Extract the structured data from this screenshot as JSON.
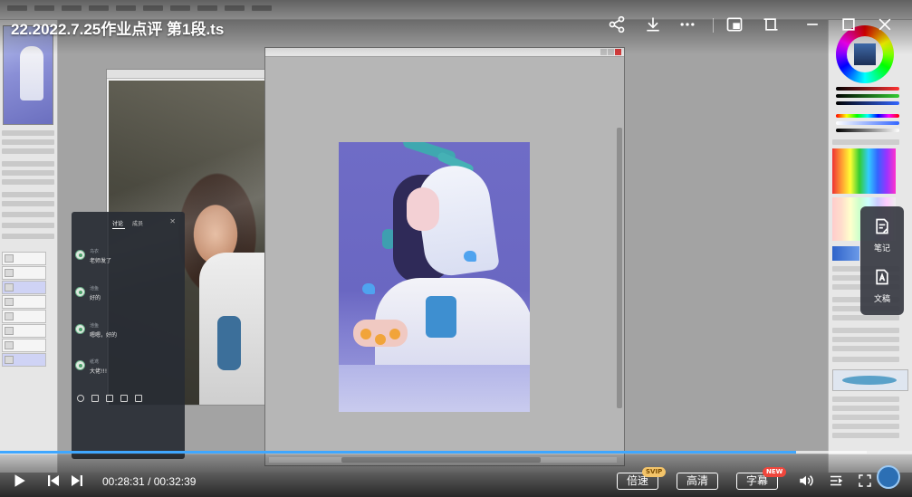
{
  "video": {
    "title": "22.2022.7.25作业点评 第1段.ts",
    "current_time": "00:28:31",
    "time_separator": "/",
    "total_time": "00:32:39",
    "progress_fraction": 0.873,
    "buffered_fraction": 0.95
  },
  "top_controls": {
    "icons": [
      "share-icon",
      "download-icon",
      "more-icon",
      "picture-in-picture-icon",
      "pin-on-top-icon",
      "minimize-icon",
      "maximize-icon",
      "close-icon"
    ]
  },
  "side_tools": {
    "notes_label": "笔记",
    "manuscript_label": "文稿"
  },
  "bottom_controls": {
    "speed_label": "倍速",
    "speed_badge": "SVIP",
    "quality_label": "高清",
    "subtitle_label": "字幕",
    "subtitle_badge": "NEW"
  },
  "chat": {
    "tab_comments": "讨论",
    "tab_other": "成员",
    "messages": [
      {
        "nick": "乌衣",
        "text": "老师发了"
      },
      {
        "nick": "池鱼",
        "text": "好的"
      },
      {
        "nick": "池鱼",
        "text": "嗯嗯，好的"
      },
      {
        "nick": "纸鸢",
        "text": "大佬!!!"
      }
    ]
  },
  "colors": {
    "progress": "#3fa7ff",
    "accent_badge_svip": "#f3c46a",
    "accent_badge_new": "#f0463c"
  }
}
